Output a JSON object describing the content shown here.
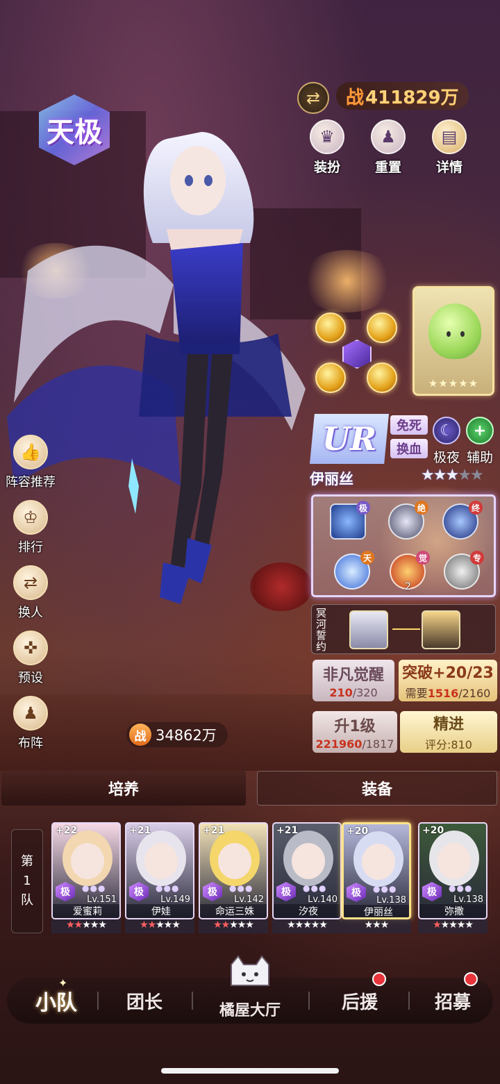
{
  "header": {
    "rank_badge": "天极",
    "total_power_prefix": "战",
    "total_power_value": "411829万",
    "actions": [
      {
        "label": "装扮",
        "icon": "outfit-icon"
      },
      {
        "label": "重置",
        "icon": "reset-icon"
      },
      {
        "label": "详情",
        "icon": "book-icon"
      }
    ]
  },
  "side_menu": [
    {
      "label": "阵容推荐",
      "icon": "thumbs-up-icon"
    },
    {
      "label": "排行",
      "icon": "trophy-icon"
    },
    {
      "label": "换人",
      "icon": "swap-icon"
    },
    {
      "label": "预设",
      "icon": "gamepad-icon"
    },
    {
      "label": "布阵",
      "icon": "chess-pieces-icon"
    }
  ],
  "team_power": {
    "prefix": "战",
    "value": "34862万"
  },
  "character": {
    "rarity": "UR",
    "traits": [
      "免死",
      "换血"
    ],
    "classes": [
      {
        "label": "极夜",
        "icon": "moon-icon",
        "color": "#4a3c8c"
      },
      {
        "label": "辅助",
        "icon": "plus-icon",
        "color": "#2f8a3a"
      }
    ],
    "name": "伊丽丝",
    "stars_filled": 3,
    "stars_total": 5,
    "skills": [
      {
        "tag": "极",
        "tag_color": "#7a5ac8"
      },
      {
        "tag": "绝",
        "tag_color": "#e0761e"
      },
      {
        "tag": "终",
        "tag_color": "#d23a3a"
      },
      {
        "tag": "天",
        "tag_color": "#e0761e"
      },
      {
        "tag": "觉",
        "tag_color": "#d04a7a",
        "count": "2"
      },
      {
        "tag": "专",
        "tag_color": "#d23a3a"
      }
    ],
    "bond_title": "冥河誓约"
  },
  "stats": {
    "awaken": {
      "title": "非凡觉醒",
      "current": "210",
      "max": "/320"
    },
    "breakthrough": {
      "title": "突破+20/23",
      "prefix": "需要",
      "current": "1516",
      "max": "/2160"
    },
    "levelup": {
      "title": "升1级",
      "current": "221960",
      "max": "/1817"
    },
    "refine": {
      "title": "精进",
      "score": "评分:810"
    }
  },
  "tabs": [
    "培养",
    "装备"
  ],
  "team": {
    "label_chars": [
      "第",
      "1",
      "队"
    ],
    "heroes": [
      {
        "plus": "+22",
        "rarity": "极",
        "level": "Lv.151",
        "name": "爱蜜莉",
        "red_stars": 2,
        "white_stars": 3,
        "hair": "#f2d7b0",
        "bg": "#f6d9e6"
      },
      {
        "plus": "+21",
        "rarity": "极",
        "level": "Lv.149",
        "name": "伊娃",
        "red_stars": 2,
        "white_stars": 3,
        "hair": "#e8e4ee",
        "bg": "#d9cde8"
      },
      {
        "plus": "+21",
        "rarity": "极",
        "level": "Lv.142",
        "name": "命运三姝",
        "red_stars": 2,
        "white_stars": 3,
        "hair": "#f4d66a",
        "bg": "#f2e2b8"
      },
      {
        "plus": "+21",
        "rarity": "极",
        "level": "Lv.140",
        "name": "汐夜",
        "red_stars": 0,
        "white_stars": 5,
        "hair": "#b9bcc6",
        "bg": "#5a5e6c"
      },
      {
        "plus": "+20",
        "rarity": "极",
        "level": "Lv.138",
        "name": "伊丽丝",
        "red_stars": 0,
        "white_stars": 3,
        "hair": "#d8dcf2",
        "bg": "#b5b8da"
      },
      {
        "plus": "+20",
        "rarity": "极",
        "level": "Lv.138",
        "name": "弥撒",
        "red_stars": 1,
        "white_stars": 4,
        "hair": "#e6e6ea",
        "bg": "#3d5a3a"
      }
    ]
  },
  "bottom_nav": [
    {
      "label": "小队",
      "active": true,
      "dot": false
    },
    {
      "label": "团长",
      "active": false,
      "dot": false
    },
    {
      "label": "橘屋大厅",
      "active": false,
      "dot": false
    },
    {
      "label": "后援",
      "active": false,
      "dot": true
    },
    {
      "label": "招募",
      "active": false,
      "dot": true
    }
  ]
}
